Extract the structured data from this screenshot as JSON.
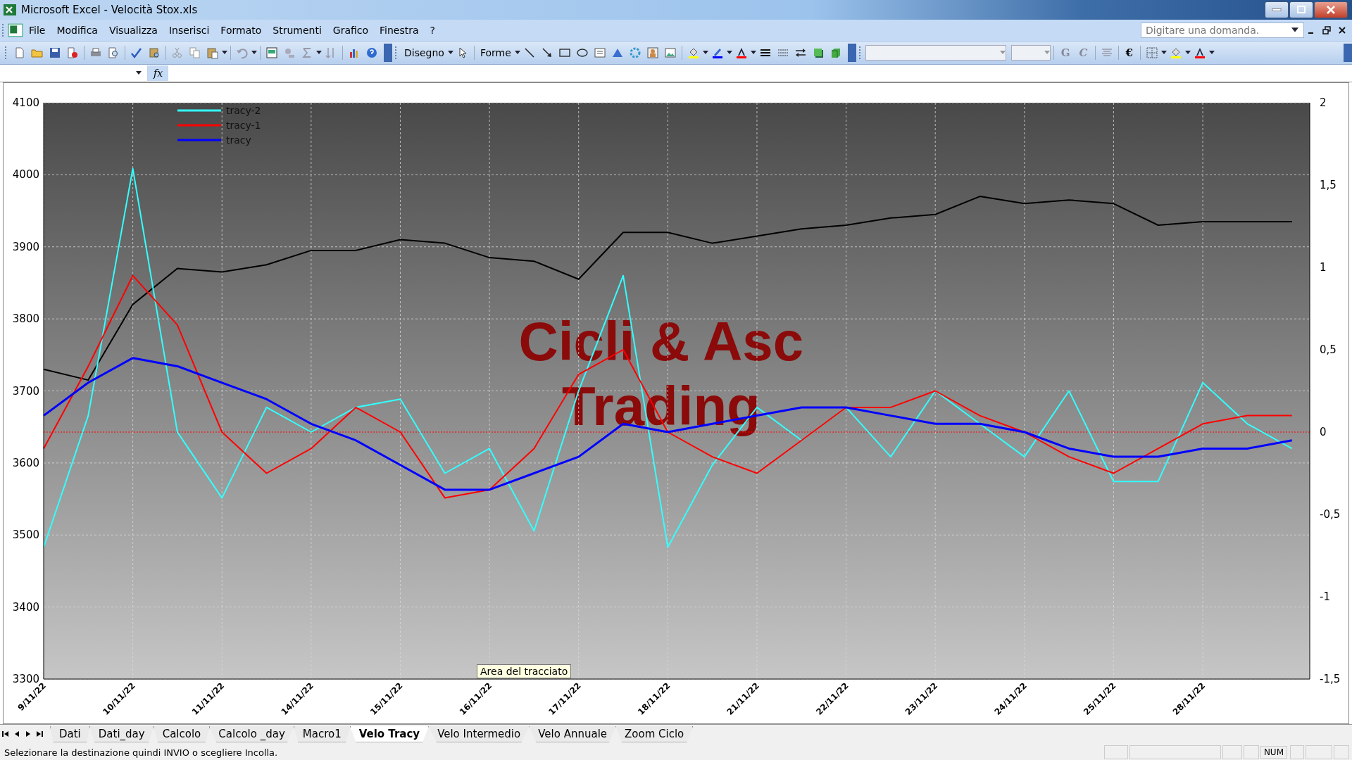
{
  "window": {
    "title": "Microsoft Excel - Velocità Stox.xls"
  },
  "menu": [
    {
      "label": "File"
    },
    {
      "label": "Modifica"
    },
    {
      "label": "Visualizza"
    },
    {
      "label": "Inserisci"
    },
    {
      "label": "Formato"
    },
    {
      "label": "Strumenti"
    },
    {
      "label": "Grafico"
    },
    {
      "label": "Finestra"
    },
    {
      "label": "?"
    }
  ],
  "help_search": {
    "placeholder": "Digitare una domanda."
  },
  "toolbar": {
    "drawing_menu": "Disegno",
    "shapes_menu": "Forme",
    "bold": "G",
    "italic": "C",
    "euro": "€"
  },
  "formula_bar": {
    "fx_label": "fx"
  },
  "chart": {
    "tooltip": "Area del tracciato",
    "chart_data": {
      "type": "line",
      "categories": [
        "9/11/22",
        null,
        "10/11/22",
        null,
        "11/11/22",
        null,
        "14/11/22",
        null,
        "15/11/22",
        null,
        "16/11/22",
        null,
        "17/11/22",
        null,
        "18/11/22",
        null,
        "21/11/22",
        null,
        "22/11/22",
        null,
        "23/11/22",
        null,
        "24/11/22",
        null,
        "25/11/22",
        null,
        "28/11/22",
        null,
        null
      ],
      "ylim": [
        3300,
        4100
      ],
      "yticks": [
        3300,
        3400,
        3500,
        3600,
        3700,
        3800,
        3900,
        4000,
        4100
      ],
      "y2lim": [
        -1.5,
        2
      ],
      "y2ticks": [
        {
          "value": -1.5,
          "label": "-1,5"
        },
        {
          "value": -1,
          "label": "-1"
        },
        {
          "value": -0.5,
          "label": "-0,5"
        },
        {
          "value": 0,
          "label": "0"
        },
        {
          "value": 0.5,
          "label": "0,5"
        },
        {
          "value": 1,
          "label": "1"
        },
        {
          "value": 1.5,
          "label": "1,5"
        },
        {
          "value": 2,
          "label": "2"
        }
      ],
      "series": [
        {
          "color": "#000000",
          "values": [
            3730,
            3715,
            3820,
            3870,
            3865,
            3875,
            3895,
            3895,
            3910,
            3905,
            3885,
            3880,
            3855,
            3920,
            3920,
            3905,
            3915,
            3925,
            3930,
            3940,
            3945,
            3970,
            3960,
            3965,
            3960,
            3930,
            3935,
            3935,
            3935
          ]
        },
        {
          "name": "tracy-2",
          "color": "#33ffff",
          "axis": "y2",
          "values": [
            -0.7,
            0.1,
            1.6,
            0,
            -0.4,
            0.15,
            0,
            0.15,
            0.2,
            -0.25,
            -0.1,
            -0.6,
            0.25,
            0.95,
            -0.7,
            -0.2,
            0.15,
            -0.05,
            0.15,
            -0.15,
            0.25,
            0.05,
            -0.15,
            0.25,
            -0.3,
            -0.3,
            0.3,
            0.05,
            -0.1
          ]
        },
        {
          "name": "tracy-1",
          "color": "#ff0000",
          "axis": "y2",
          "values": [
            -0.1,
            0.4,
            0.95,
            0.65,
            0,
            -0.25,
            -0.1,
            0.15,
            0,
            -0.4,
            -0.35,
            -0.1,
            0.35,
            0.5,
            0,
            -0.15,
            -0.25,
            -0.05,
            0.15,
            0.15,
            0.25,
            0.1,
            0,
            -0.15,
            -0.25,
            -0.1,
            0.05,
            0.1,
            0.1
          ]
        },
        {
          "name": "tracy",
          "color": "#0000ff",
          "axis": "y2",
          "values": [
            0.1,
            0.3,
            0.45,
            0.4,
            0.3,
            0.2,
            0.05,
            -0.05,
            -0.2,
            -0.35,
            -0.35,
            -0.25,
            -0.15,
            0.05,
            0,
            0.05,
            0.1,
            0.15,
            0.15,
            0.1,
            0.05,
            0.05,
            0,
            -0.1,
            -0.15,
            -0.15,
            -0.1,
            -0.1,
            -0.05
          ]
        }
      ],
      "ref_lines": [
        {
          "axis": "y2",
          "value": 0,
          "color": "#ff0000"
        }
      ],
      "grid": true,
      "legend": true
    },
    "overlay_texts": [
      "Cicli & Asc",
      "Trading"
    ]
  },
  "sheet_tabs": [
    {
      "label": "Dati",
      "selected": false
    },
    {
      "label": "Dati_day",
      "selected": false
    },
    {
      "label": "Calcolo",
      "selected": false
    },
    {
      "label": "Calcolo _day",
      "selected": false
    },
    {
      "label": "Macro1",
      "selected": false
    },
    {
      "label": "Velo Tracy",
      "selected": true
    },
    {
      "label": "Velo Intermedio",
      "selected": false
    },
    {
      "label": "Velo Annuale",
      "selected": false
    },
    {
      "label": "Zoom Ciclo",
      "selected": false
    }
  ],
  "status_bar": {
    "message": "Selezionare la destinazione quindi INVIO o scegliere Incolla.",
    "indicators": [
      "NUM"
    ]
  }
}
